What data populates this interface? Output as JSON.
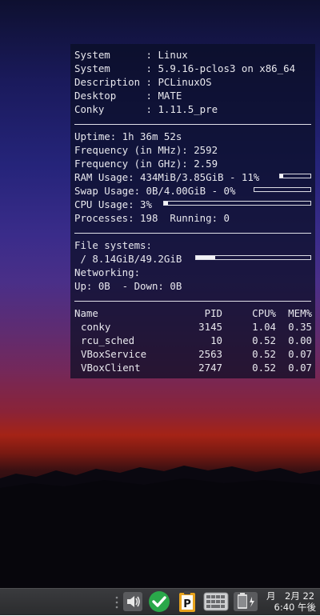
{
  "conky": {
    "info": [
      {
        "label": "System     ",
        "value": ": Linux"
      },
      {
        "label": "System     ",
        "value": ": 5.9.16-pclos3 on x86_64"
      },
      {
        "label": "Description",
        "value": ": PCLinuxOS"
      },
      {
        "label": "Desktop    ",
        "value": ": MATE"
      },
      {
        "label": "Conky      ",
        "value": ": 1.11.5_pre"
      }
    ],
    "uptime": "Uptime: 1h 36m 52s",
    "freq_mhz": "Frequency (in MHz): 2592",
    "freq_ghz": "Frequency (in GHz): 2.59",
    "ram": {
      "text": "RAM Usage: 434MiB/3.85GiB - 11%",
      "percent": 11
    },
    "swap": {
      "text": "Swap Usage: 0B/4.00GiB - 0%",
      "percent": 0
    },
    "cpu": {
      "text": "CPU Usage: 3%",
      "percent": 3
    },
    "processes": "Processes: 198  Running: 0",
    "fs_label": "File systems:",
    "fs": {
      "text": " / 8.14GiB/49.2GiB",
      "percent": 16.5
    },
    "net_label": "Networking:",
    "net": "Up: 0B  - Down: 0B",
    "proc_headers": {
      "name": "Name",
      "pid": "PID",
      "cpu": "CPU%",
      "mem": "MEM%"
    },
    "procs": [
      {
        "name": "conky",
        "pid": "3145",
        "cpu": "1.04",
        "mem": "0.35"
      },
      {
        "name": "rcu_sched",
        "pid": "10",
        "cpu": "0.52",
        "mem": "0.00"
      },
      {
        "name": "VBoxService",
        "pid": "2563",
        "cpu": "0.52",
        "mem": "0.07"
      },
      {
        "name": "VBoxClient",
        "pid": "2747",
        "cpu": "0.52",
        "mem": "0.07"
      }
    ]
  },
  "panel": {
    "icons": [
      "volume-icon",
      "update-checkmark-icon",
      "clipboard-p-icon",
      "keyboard-icon",
      "power-battery-icon"
    ],
    "clock_line1": "月　2月 22",
    "clock_line2": "6:40 午後"
  }
}
